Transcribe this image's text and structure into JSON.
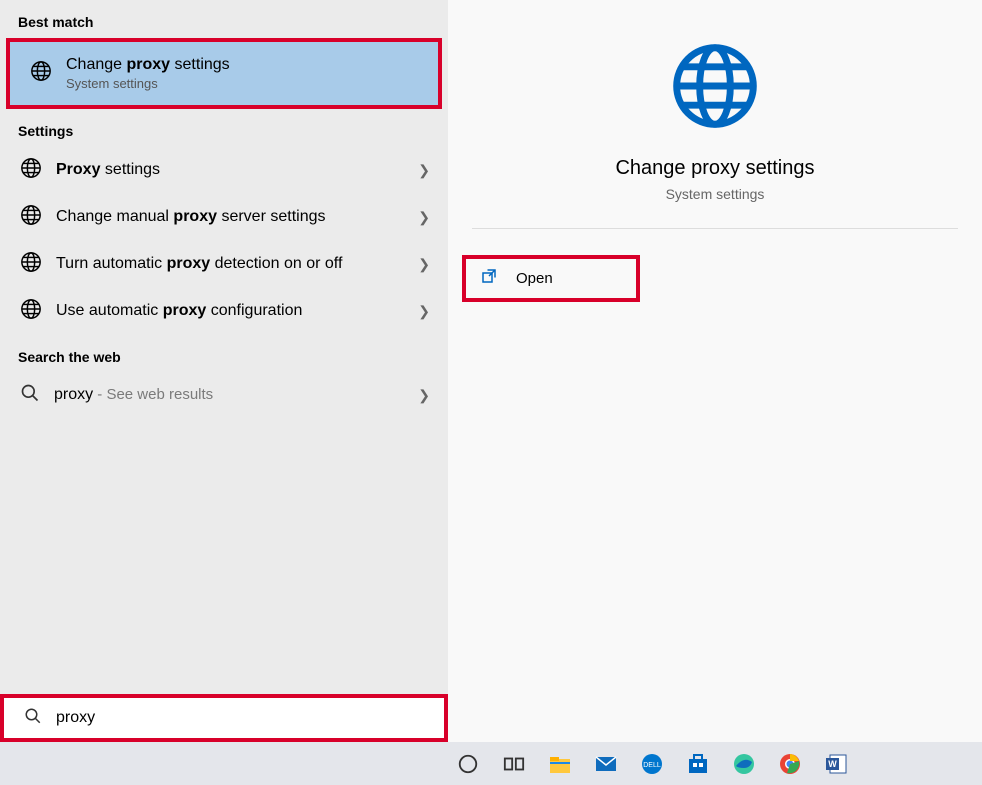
{
  "left": {
    "best_match_header": "Best match",
    "best_match": {
      "title_pre": "Change ",
      "title_bold": "proxy",
      "title_post": " settings",
      "subtitle": "System settings"
    },
    "settings_header": "Settings",
    "settings_items": [
      {
        "pre": "",
        "bold": "Proxy",
        "post": " settings"
      },
      {
        "pre": "Change manual ",
        "bold": "proxy",
        "post": " server settings"
      },
      {
        "pre": "Turn automatic ",
        "bold": "proxy",
        "post": " detection on or off"
      },
      {
        "pre": "Use automatic ",
        "bold": "proxy",
        "post": " configuration"
      }
    ],
    "web_header": "Search the web",
    "web_item": {
      "term": "proxy",
      "suffix": " - See web results"
    }
  },
  "right": {
    "title": "Change proxy settings",
    "subtitle": "System settings",
    "open_label": "Open"
  },
  "search": {
    "value": "proxy"
  },
  "colors": {
    "selection": "#a8cbe9",
    "highlight": "#d8002a",
    "accent": "#0067c0"
  }
}
